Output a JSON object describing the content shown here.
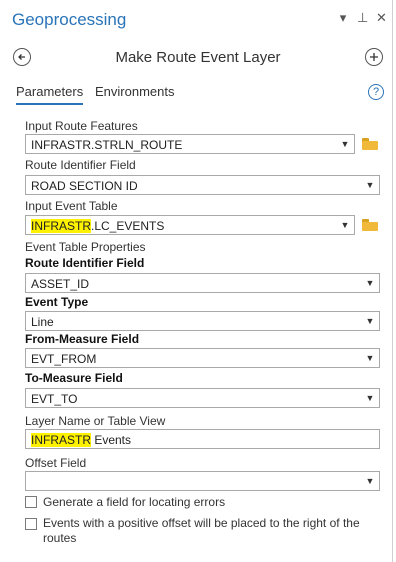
{
  "pane": {
    "title": "Geoprocessing",
    "title_icons": [
      "▾",
      "⊥",
      "✕"
    ]
  },
  "tool": {
    "title": "Make Route Event Layer"
  },
  "tabs": {
    "parameters": "Parameters",
    "environments": "Environments",
    "help": "?"
  },
  "params": {
    "input_route_features": {
      "label": "Input Route Features",
      "value": "INFRASTR.STRLN_ROUTE"
    },
    "route_identifier_field": {
      "label": "Route Identifier Field",
      "value": "ROAD SECTION ID"
    },
    "input_event_table": {
      "label": "Input Event Table",
      "value_hl": "INFRASTR",
      "value_rest": ".LC_EVENTS"
    },
    "event_table_properties": {
      "label": "Event Table Properties"
    },
    "event_route_identifier_field": {
      "label": "Route Identifier Field",
      "value": "ASSET_ID"
    },
    "event_type": {
      "label": "Event Type",
      "value": "Line"
    },
    "from_measure_field": {
      "label": "From-Measure Field",
      "value": "EVT_FROM"
    },
    "to_measure_field": {
      "label": "To-Measure Field",
      "value": "EVT_TO"
    },
    "layer_name": {
      "label": "Layer Name or Table View",
      "value_hl": "INFRASTR",
      "value_rest": " Events"
    },
    "offset_field": {
      "label": "Offset Field",
      "value": ""
    },
    "generate_error_field": {
      "label": "Generate a field for locating errors",
      "checked": false
    },
    "positive_offset_right": {
      "label": "Events with a positive offset will be placed to the right of the routes",
      "checked": false
    }
  },
  "colors": {
    "accent": "#2a74b8",
    "highlight": "#fff200",
    "folder": "#f0b93a"
  }
}
